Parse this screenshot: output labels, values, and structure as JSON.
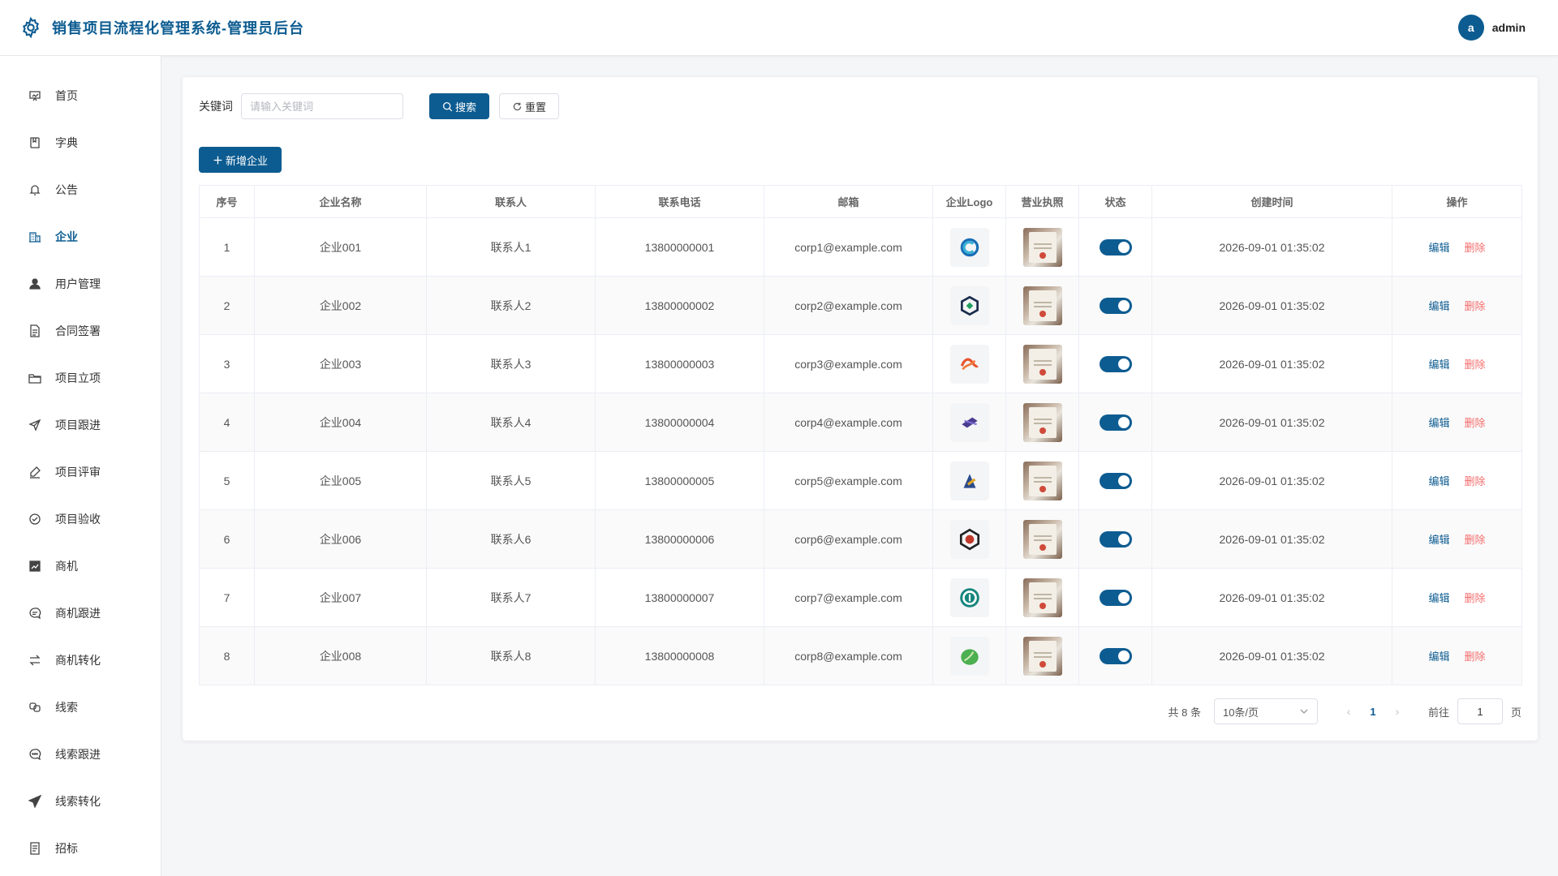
{
  "header": {
    "title": "销售项目流程化管理系统-管理员后台",
    "avatar_letter": "a",
    "username": "admin"
  },
  "sidebar": {
    "items": [
      {
        "label": "首页",
        "icon": "chart-board-icon"
      },
      {
        "label": "字典",
        "icon": "book-icon"
      },
      {
        "label": "公告",
        "icon": "bell-icon"
      },
      {
        "label": "企业",
        "icon": "building-icon",
        "active": true
      },
      {
        "label": "用户管理",
        "icon": "user-icon"
      },
      {
        "label": "合同签署",
        "icon": "document-icon"
      },
      {
        "label": "项目立项",
        "icon": "folder-icon"
      },
      {
        "label": "项目跟进",
        "icon": "send-icon"
      },
      {
        "label": "项目评审",
        "icon": "edit-pen-icon"
      },
      {
        "label": "项目验收",
        "icon": "check-circle-icon"
      },
      {
        "label": "商机",
        "icon": "trend-chart-icon"
      },
      {
        "label": "商机跟进",
        "icon": "chat-icon"
      },
      {
        "label": "商机转化",
        "icon": "switch-icon"
      },
      {
        "label": "线索",
        "icon": "link-icon"
      },
      {
        "label": "线索跟进",
        "icon": "chat-dots-icon"
      },
      {
        "label": "线索转化",
        "icon": "promotion-icon"
      },
      {
        "label": "招标",
        "icon": "tickets-icon"
      }
    ]
  },
  "search": {
    "label": "关键词",
    "placeholder": "请输入关键词",
    "search_btn": "搜索",
    "reset_btn": "重置"
  },
  "add_btn": "新增企业",
  "table": {
    "headers": [
      "序号",
      "企业名称",
      "联系人",
      "联系电话",
      "邮箱",
      "企业Logo",
      "营业执照",
      "状态",
      "创建时间",
      "操作"
    ],
    "edit_label": "编辑",
    "delete_label": "删除",
    "rows": [
      {
        "no": "1",
        "name": "企业001",
        "contact": "联系人1",
        "phone": "13800000001",
        "email": "corp1@example.com",
        "created": "2026-09-01 01:35:02",
        "enabled": true,
        "logo_color": "#1a6fb5"
      },
      {
        "no": "2",
        "name": "企业002",
        "contact": "联系人2",
        "phone": "13800000002",
        "email": "corp2@example.com",
        "created": "2026-09-01 01:35:02",
        "enabled": true,
        "logo_color": "#1f9e5f"
      },
      {
        "no": "3",
        "name": "企业003",
        "contact": "联系人3",
        "phone": "13800000003",
        "email": "corp3@example.com",
        "created": "2026-09-01 01:35:02",
        "enabled": true,
        "logo_color": "#e8552c"
      },
      {
        "no": "4",
        "name": "企业004",
        "contact": "联系人4",
        "phone": "13800000004",
        "email": "corp4@example.com",
        "created": "2026-09-01 01:35:02",
        "enabled": true,
        "logo_color": "#4b3c8f"
      },
      {
        "no": "5",
        "name": "企业005",
        "contact": "联系人5",
        "phone": "13800000005",
        "email": "corp5@example.com",
        "created": "2026-09-01 01:35:02",
        "enabled": true,
        "logo_color": "#2a4b8d"
      },
      {
        "no": "6",
        "name": "企业006",
        "contact": "联系人6",
        "phone": "13800000006",
        "email": "corp6@example.com",
        "created": "2026-09-01 01:35:02",
        "enabled": true,
        "logo_color": "#c0392b"
      },
      {
        "no": "7",
        "name": "企业007",
        "contact": "联系人7",
        "phone": "13800000007",
        "email": "corp7@example.com",
        "created": "2026-09-01 01:35:02",
        "enabled": true,
        "logo_color": "#15857c"
      },
      {
        "no": "8",
        "name": "企业008",
        "contact": "联系人8",
        "phone": "13800000008",
        "email": "corp8@example.com",
        "created": "2026-09-01 01:35:02",
        "enabled": true,
        "logo_color": "#4caf50"
      }
    ]
  },
  "pagination": {
    "total_text": "共 8 条",
    "page_size": "10条/页",
    "current_page": "1",
    "goto_label": "前往",
    "goto_value": "1",
    "page_suffix": "页"
  },
  "colors": {
    "primary": "#0d5c91",
    "danger": "#f56c6c"
  }
}
